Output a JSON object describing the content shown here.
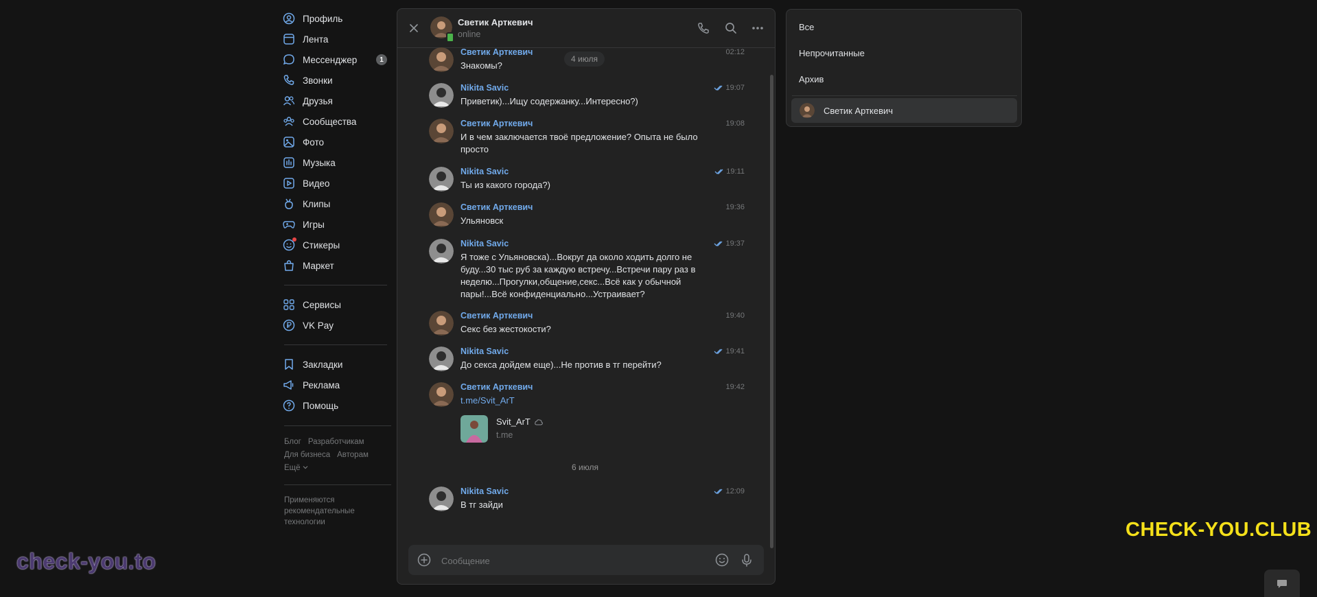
{
  "nav": {
    "items": [
      {
        "label": "Профиль",
        "icon": "profile-icon"
      },
      {
        "label": "Лента",
        "icon": "feed-icon"
      },
      {
        "label": "Мессенджер",
        "icon": "messenger-icon",
        "badge": "1"
      },
      {
        "label": "Звонки",
        "icon": "phone-icon"
      },
      {
        "label": "Друзья",
        "icon": "friends-icon"
      },
      {
        "label": "Сообщества",
        "icon": "communities-icon"
      },
      {
        "label": "Фото",
        "icon": "photo-icon"
      },
      {
        "label": "Музыка",
        "icon": "music-icon"
      },
      {
        "label": "Видео",
        "icon": "video-icon"
      },
      {
        "label": "Клипы",
        "icon": "clips-icon"
      },
      {
        "label": "Игры",
        "icon": "games-icon"
      },
      {
        "label": "Стикеры",
        "icon": "stickers-icon"
      },
      {
        "label": "Маркет",
        "icon": "market-icon"
      }
    ],
    "items2": [
      {
        "label": "Сервисы",
        "icon": "services-icon"
      },
      {
        "label": "VK Pay",
        "icon": "vkpay-icon"
      }
    ],
    "items3": [
      {
        "label": "Закладки",
        "icon": "bookmark-icon"
      },
      {
        "label": "Реклама",
        "icon": "ads-icon"
      },
      {
        "label": "Помощь",
        "icon": "help-icon"
      }
    ],
    "footer": {
      "blog": "Блог",
      "developers": "Разработчикам",
      "business": "Для бизнеса",
      "authors": "Авторам",
      "more": "Ещё",
      "note": "Применяются рекомендательные технологии"
    }
  },
  "chat": {
    "header": {
      "name": "Светик Арткевич",
      "status": "online"
    },
    "messages": [
      {
        "author": "Светик Арткевич",
        "time": "02:12",
        "text": "Знакомы?"
      },
      {
        "author": "Nikita Savic",
        "time": "19:07",
        "text": "Приветик)...Ищу содержанку...Интересно?)"
      },
      {
        "author": "Светик Арткевич",
        "time": "19:08",
        "text": "И в чем заключается твоё предложение? Опыта не было просто"
      },
      {
        "author": "Nikita Savic",
        "time": "19:11",
        "text": "Ты из какого города?)"
      },
      {
        "author": "Светик Арткевич",
        "time": "19:36",
        "text": "Ульяновск"
      },
      {
        "author": "Nikita Savic",
        "time": "19:37",
        "text": "Я тоже с Ульяновска)...Вокруг да около ходить долго не буду...30 тыс руб за каждую встречу...Встречи пару раз в неделю...Прогулки,общение,секс...Всё как у обычной пары!...Всё конфиденциально...Устраивает?"
      },
      {
        "author": "Светик Арткевич",
        "time": "19:40",
        "text": "Секс без жестокости?"
      },
      {
        "author": "Nikita Savic",
        "time": "19:41",
        "text": "До секса дойдем еще)...Не против в тг перейти?"
      },
      {
        "author": "Светик Арткевич",
        "time": "19:42",
        "text": "t.me/Svit_ArT"
      },
      {
        "author": "Nikita Savic",
        "time": "12:09",
        "text": "В тг зайди"
      }
    ],
    "date1": "4 июля",
    "date2": "6 июля",
    "snippet": {
      "title": "Svit_ArT",
      "domain": "t.me"
    },
    "composer": {
      "placeholder": "Сообщение"
    }
  },
  "filters": {
    "all": "Все",
    "unread": "Непрочитанные",
    "archive": "Архив",
    "conversation": "Светик Арткевич"
  },
  "watermarks": {
    "left": "check-you.to",
    "right": "CHECK-YOU.CLUB"
  },
  "colors": {
    "link": "#71aaeb",
    "background": "#141414",
    "panel": "#222222",
    "watermark_right": "#f4e01a"
  }
}
